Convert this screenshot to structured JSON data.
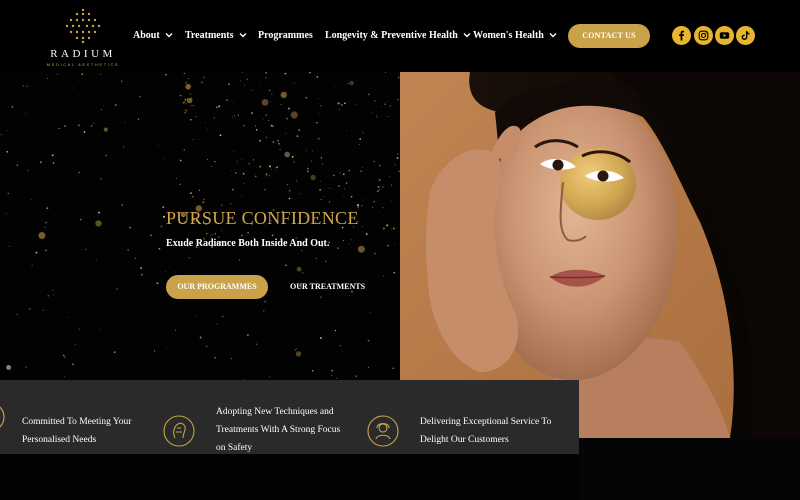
{
  "brand": {
    "name": "RADIUM",
    "tagline": "MEDICAL AESTHETICS",
    "gold": "#c9a24a"
  },
  "nav": {
    "items": [
      {
        "label": "About",
        "has_dropdown": true
      },
      {
        "label": "Treatments",
        "has_dropdown": true
      },
      {
        "label": "Programmes",
        "has_dropdown": false
      },
      {
        "label": "Longevity & Preventive Health",
        "has_dropdown": true
      },
      {
        "label": "Women's Health",
        "has_dropdown": true
      }
    ],
    "contact_label": "CONTACT US",
    "social_icons": [
      "facebook-icon",
      "instagram-icon",
      "youtube-icon",
      "tiktok-icon"
    ]
  },
  "hero": {
    "title": "PURSUE CONFIDENCE",
    "subtitle": "Exude Radiance Both Inside And Out.",
    "primary_button": "OUR PROGRAMMES",
    "secondary_button": "OUR TREATMENTS"
  },
  "features": [
    {
      "text_lines": [
        "Committed To Meeting Your",
        "Personalised Needs"
      ],
      "icon": "ornament-icon"
    },
    {
      "text_lines": [
        "Adopting New Techniques and",
        "Treatments With A Strong Focus",
        "on Safety"
      ],
      "icon": "face-care-icon"
    },
    {
      "text_lines": [
        "Delivering Exceptional Service To",
        "Delight Our Customers"
      ],
      "icon": "customer-service-icon"
    }
  ]
}
